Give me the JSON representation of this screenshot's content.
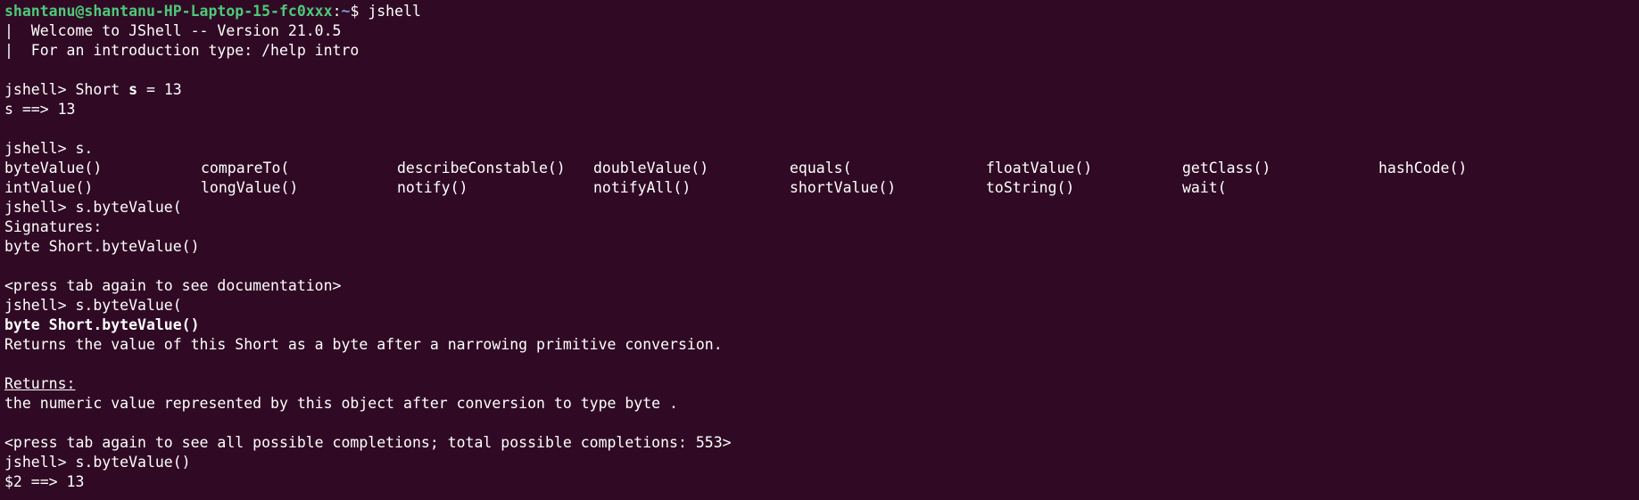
{
  "shell_prompt": {
    "user_host": "shantanu@shantanu-HP-Laptop-15-fc0xxx",
    "colon": ":",
    "path": "~",
    "dollar": "$ ",
    "command": "jshell"
  },
  "lines": {
    "welcome": "|  Welcome to JShell -- Version 21.0.5",
    "intro": "|  For an introduction type: /help intro",
    "cmd1_prompt": "jshell> ",
    "cmd1_pre": "Short ",
    "cmd1_bold": "s",
    "cmd1_post": " = 13",
    "out1": "s ==> 13",
    "cmd2": "jshell> s.",
    "cmd3": "jshell> s.byteValue(",
    "signatures_label": "Signatures:",
    "signature": "byte Short.byteValue()",
    "press_tab_doc": "<press tab again to see documentation>",
    "cmd4": "jshell> s.byteValue(",
    "doc_signature": "byte Short.byteValue()",
    "doc_description": "Returns the value of this Short as a byte after a narrowing primitive conversion.",
    "returns_label": "Returns:",
    "returns_text": "the numeric value represented by this object after conversion to type byte .",
    "press_tab_all": "<press tab again to see all possible completions; total possible completions: 553>",
    "cmd5": "jshell> s.byteValue()",
    "out5": "$2 ==> 13"
  },
  "completions": {
    "row1": [
      "byteValue()",
      "compareTo(",
      "describeConstable()",
      "doubleValue()",
      "equals(",
      "floatValue()",
      "getClass()",
      "hashCode()"
    ],
    "row2": [
      "intValue()",
      "longValue()",
      "notify()",
      "notifyAll()",
      "shortValue()",
      "toString()",
      "wait("
    ]
  },
  "colors": {
    "background": "#300a24",
    "text": "#ffffff",
    "prompt_user": "#4ec979",
    "prompt_path": "#729fcf"
  }
}
